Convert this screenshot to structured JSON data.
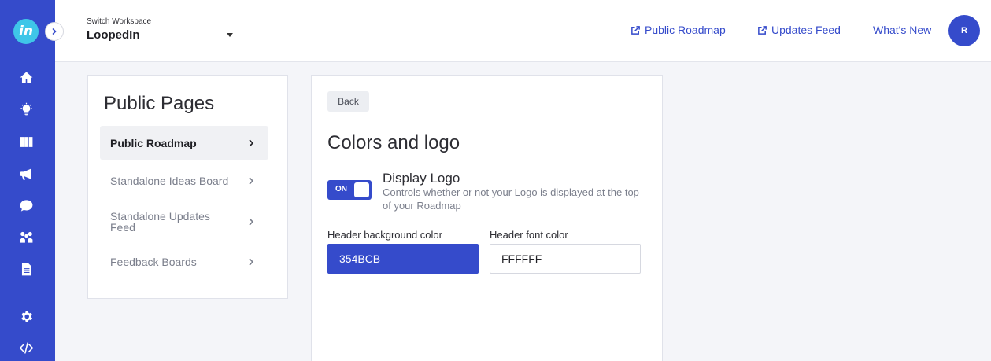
{
  "sidebar": {
    "logo_text": "in",
    "icons": [
      "home-icon",
      "lightbulb-icon",
      "board-icon",
      "megaphone-icon",
      "chat-icon",
      "team-icon",
      "document-icon",
      "settings-icon",
      "code-icon"
    ]
  },
  "header": {
    "workspace_label": "Switch Workspace",
    "workspace_name": "LoopedIn",
    "links": {
      "public_roadmap": "Public Roadmap",
      "updates_feed": "Updates Feed",
      "whats_new": "What's New"
    },
    "avatar_initial": "R"
  },
  "public_pages": {
    "title": "Public Pages",
    "items": [
      {
        "label": "Public Roadmap",
        "active": true
      },
      {
        "label": "Standalone Ideas Board",
        "active": false
      },
      {
        "label": "Standalone Updates Feed",
        "active": false
      },
      {
        "label": "Feedback Boards",
        "active": false
      }
    ]
  },
  "settings": {
    "back_label": "Back",
    "title": "Colors and logo",
    "display_logo": {
      "toggle_state": "ON",
      "title": "Display Logo",
      "description": "Controls whether or not your Logo is displayed at the top of your Roadmap"
    },
    "header_bg": {
      "label": "Header background color",
      "value": "354BCB"
    },
    "header_font": {
      "label": "Header font color",
      "value": "FFFFFF"
    }
  },
  "colors": {
    "accent": "#354bcb",
    "logo": "#3fc6e8",
    "background": "#f4f5f9"
  }
}
